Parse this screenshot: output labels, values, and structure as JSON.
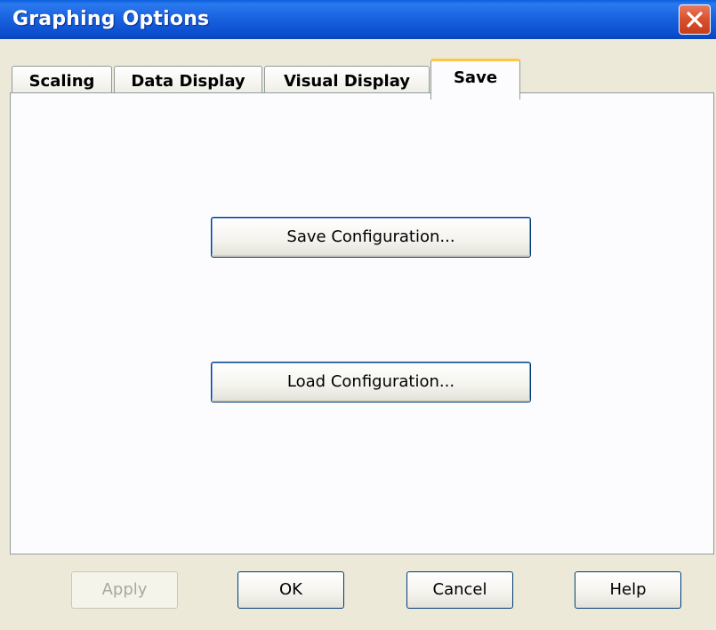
{
  "window": {
    "title": "Graphing Options"
  },
  "tabs": [
    {
      "label": "Scaling",
      "active": false
    },
    {
      "label": "Data Display",
      "active": false
    },
    {
      "label": "Visual Display",
      "active": false
    },
    {
      "label": "Save",
      "active": true
    }
  ],
  "save_panel": {
    "save_config_label": "Save Configuration...",
    "load_config_label": "Load Configuration..."
  },
  "footer": {
    "apply_label": "Apply",
    "apply_enabled": false,
    "ok_label": "OK",
    "cancel_label": "Cancel",
    "help_label": "Help"
  },
  "colors": {
    "titlebar": "#0c4fcf",
    "close_button": "#d8502d",
    "dialog_background": "#ece9d8",
    "active_tab_highlight": "#ffc83c"
  },
  "icons": {
    "close": "close-icon"
  }
}
